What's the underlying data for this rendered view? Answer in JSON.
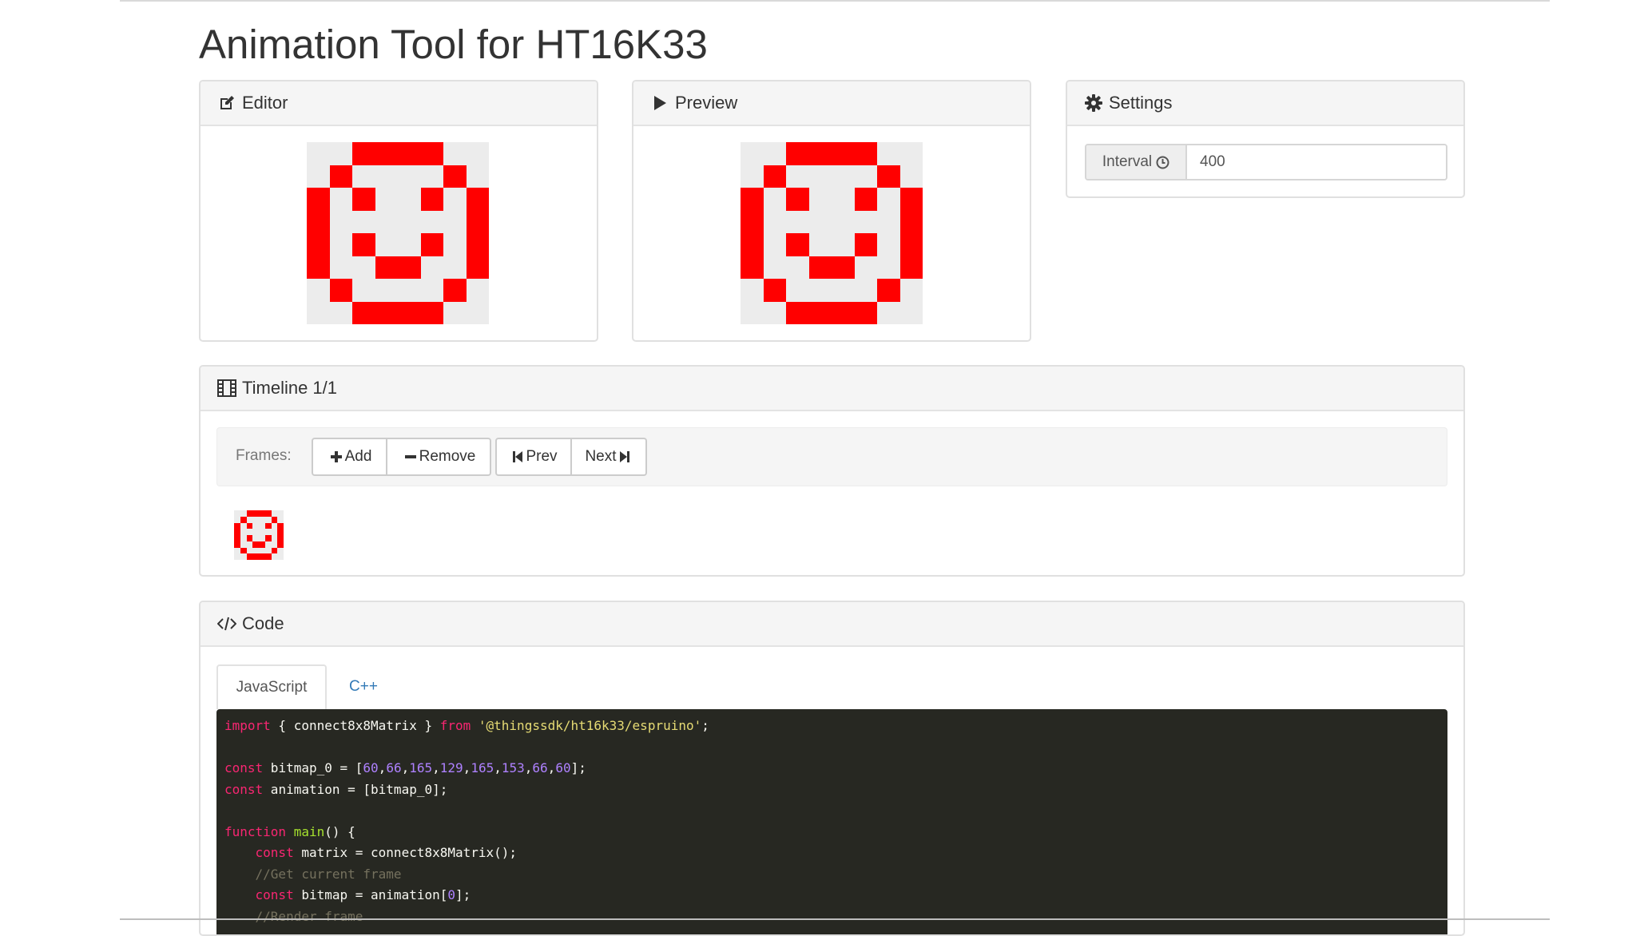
{
  "title": "Animation Tool for HT16K33",
  "colors": {
    "led_on": "#ff0000",
    "led_off": "#ececec",
    "link": "#337ab7",
    "code_bg": "#272822"
  },
  "editor": {
    "heading": "Editor",
    "icon": "edit-icon",
    "bitmap_rows": [
      60,
      66,
      165,
      129,
      165,
      153,
      66,
      60
    ]
  },
  "preview": {
    "heading": "Preview",
    "icon": "play-icon",
    "bitmap_rows": [
      60,
      66,
      165,
      129,
      165,
      153,
      66,
      60
    ]
  },
  "settings": {
    "heading": "Settings",
    "icon": "gear-icon",
    "interval_label": "Interval",
    "interval_icon": "clock-icon",
    "interval_value": "400"
  },
  "timeline": {
    "heading": "Timeline 1/1",
    "icon": "film-icon",
    "frames_label": "Frames:",
    "buttons": {
      "add": "Add",
      "remove": "Remove",
      "prev": "Prev",
      "next": "Next"
    },
    "frames": [
      {
        "bitmap_rows": [
          60,
          66,
          165,
          129,
          165,
          153,
          66,
          60
        ]
      }
    ]
  },
  "code": {
    "heading": "Code",
    "icon": "code-icon",
    "tabs": [
      "JavaScript",
      "C++"
    ],
    "active_tab": "JavaScript",
    "lines": [
      [
        [
          "kw",
          "import"
        ],
        [
          "",
          " { connect8x8Matrix } "
        ],
        [
          "kw",
          "from"
        ],
        [
          "",
          " "
        ],
        [
          "str",
          "'@thingssdk/ht16k33/espruino'"
        ],
        [
          "",
          ";"
        ]
      ],
      [],
      [
        [
          "kw",
          "const"
        ],
        [
          "",
          " bitmap_0 = ["
        ],
        [
          "num",
          "60"
        ],
        [
          "",
          ","
        ],
        [
          "num",
          "66"
        ],
        [
          "",
          ","
        ],
        [
          "num",
          "165"
        ],
        [
          "",
          ","
        ],
        [
          "num",
          "129"
        ],
        [
          "",
          ","
        ],
        [
          "num",
          "165"
        ],
        [
          "",
          ","
        ],
        [
          "num",
          "153"
        ],
        [
          "",
          ","
        ],
        [
          "num",
          "66"
        ],
        [
          "",
          ","
        ],
        [
          "num",
          "60"
        ],
        [
          "",
          "];"
        ]
      ],
      [
        [
          "kw",
          "const"
        ],
        [
          "",
          " animation = [bitmap_0];"
        ]
      ],
      [],
      [
        [
          "kw",
          "function"
        ],
        [
          "",
          " "
        ],
        [
          "fn",
          "main"
        ],
        [
          "",
          "() {"
        ]
      ],
      [
        [
          "",
          "    "
        ],
        [
          "kw",
          "const"
        ],
        [
          "",
          " matrix = connect8x8Matrix();"
        ]
      ],
      [
        [
          "",
          "    "
        ],
        [
          "cm",
          "//Get current frame"
        ]
      ],
      [
        [
          "",
          "    "
        ],
        [
          "kw",
          "const"
        ],
        [
          "",
          " bitmap = animation["
        ],
        [
          "num",
          "0"
        ],
        [
          "",
          "];"
        ]
      ],
      [
        [
          "",
          "    "
        ],
        [
          "cm",
          "//Render frame"
        ]
      ]
    ]
  }
}
